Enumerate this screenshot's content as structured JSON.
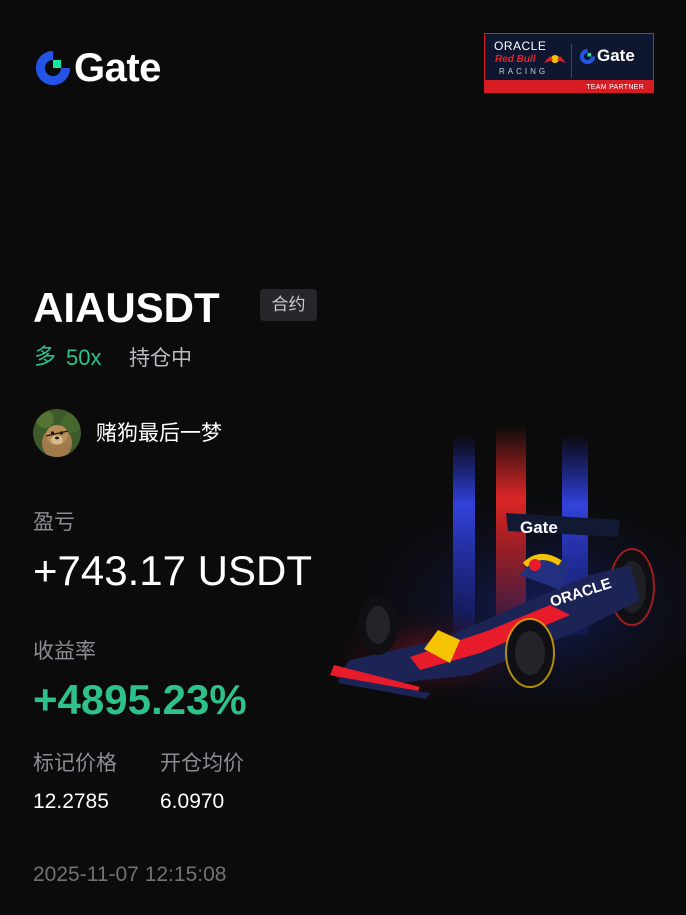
{
  "brand": {
    "name": "Gate",
    "accent_blue": "#2354e6",
    "accent_green": "#17e6a1"
  },
  "partner": {
    "oracle": "ORACLE",
    "redbull": "Red Bull",
    "racing": "RACING",
    "gate": "Gate",
    "label": "TEAM PARTNER"
  },
  "position": {
    "symbol": "AIAUSDT",
    "tag": "合约",
    "side": "多",
    "leverage": "50x",
    "status": "持仓中"
  },
  "user": {
    "name": "赌狗最后一梦",
    "avatar_icon": "dog-avatar-icon"
  },
  "stats": {
    "pnl_label": "盈亏",
    "pnl_value": "+743.17 USDT",
    "roi_label": "收益率",
    "roi_value": "+4895.23%",
    "mark_price_label": "标记价格",
    "mark_price_value": "12.2785",
    "entry_price_label": "开仓均价",
    "entry_price_value": "6.0970"
  },
  "timestamp": "2025-11-07 12:15:08",
  "colors": {
    "background": "#0b0b0c",
    "positive": "#2ec28a",
    "muted": "#8a8d94",
    "partner_red": "#d81c24",
    "partner_navy": "#0f1730"
  }
}
